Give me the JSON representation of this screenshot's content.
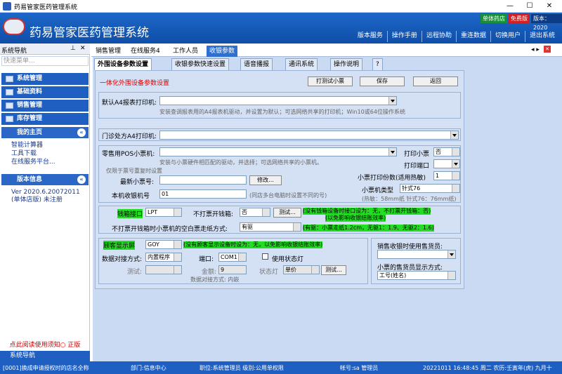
{
  "window": {
    "title": "药易管家医药管理系统",
    "min": "—",
    "max": "☐",
    "close": "✕"
  },
  "header": {
    "app_name": "药易管家医药管理系统",
    "badge1": "单体药店",
    "badge2": "免费版",
    "badge3": "版本：2020",
    "links": [
      "版本服务",
      "操作手册",
      "远程协助",
      "重连数据",
      "切换用户",
      "退出系统"
    ]
  },
  "sidebar": {
    "title": "系统导航",
    "search_placeholder": "快速菜单...",
    "menus": [
      "系统管理",
      "基础资料",
      "销售管理",
      "库存管理"
    ],
    "home_title": "我的主页",
    "home_links": [
      "智能计算器",
      "工具下载",
      "在线服务平台..."
    ],
    "ver_title": "版本信息",
    "ver_text": "Ver 2020.6.20072011",
    "ver_sub": "(单体店版) 未注册",
    "notice": "点此阅读使用须知○ 正版",
    "footer": "系统导航"
  },
  "tabs": [
    "销售管理",
    "在线服务4",
    "工作人员",
    "收银参数"
  ],
  "subtabs": [
    "外围设备参数设置",
    "收银参数快速设置",
    "语音播报",
    "通讯系统",
    "操作说明",
    "?"
  ],
  "form": {
    "section_title": "一体化外围设备参数设置",
    "btn_print": "打测试小票",
    "btn_save": "保存",
    "btn_back": "返回",
    "a4_label": "默认A4报表打印机:",
    "a4_hint": "安装查调报表用的A4报表机驱动，并设置为默认；可选网络共享的打印机；Win10或64位操作系统",
    "clinic_label": "门诊处方A4打印机:",
    "pos_label": "零售用POS小票机:",
    "pos_hint": "安装与小票硬件相匹配的驱动，并选择；可选网络共享的小票机。",
    "print_ticket_label": "打印小票",
    "print_ticket_val": "否",
    "print_port_label": "打印端口",
    "limit_title": "仅限于票号重复时设置",
    "latest_label": "最新小票号:",
    "modify_btn": "修改...",
    "copies_label": "小票打印份数(适用热敏)",
    "copies_val": "1",
    "type_label": "小票机类型",
    "type_val": "针式76",
    "type_hint": "(热敏：58mm纸  针式76：76mm纸)",
    "machine_label": "本机收银机号",
    "machine_val": "01",
    "machine_hint": "(同店多台电脑时设置不同的号)",
    "drawer_label": "钱箱接口",
    "drawer_val": "LPT",
    "nodrawer_label": "不打票开钱箱:",
    "nodrawer_val": "否",
    "test_btn": "测试...",
    "drawer_note1": "(没有钱箱设备时接口设为：无，不打票开钱箱：否)",
    "drawer_note2": "(以免影响收银结账效率)",
    "feed_label": "不打票开钱箱时小票机的空白票走纸方式:",
    "feed_val": "有驱",
    "feed_note": "(有驱：小票走纸1.2cm，无驱1：1.9、无驱2：1.6)",
    "disp_label": "顾客显示屏",
    "disp_val": "GOY",
    "disp_note": "(没有顾客显示设备时设为：无，以免影响收银结账效率)",
    "proto_label": "数据对接方式:",
    "proto_val": "内置程序",
    "port_label": "端口:",
    "port_val": "COM1",
    "status_lamp": "使用状态灯",
    "test_label": "测试:",
    "amount_label": "金额:",
    "amount_val": "9",
    "lamp_label": "状态灯",
    "lamp_val": "单价",
    "test_btn2": "测试...",
    "proto_note": "数据对接方式: 内嵌",
    "cashier_label": "销售收银时使用售货员:",
    "cashier_mode_label": "小票的售货员显示方式:",
    "cashier_mode_val": "工号(姓名)"
  },
  "status": {
    "s1": "[0001]换成申请授权时的店名全称",
    "s2": "部门:信息中心",
    "s3": "职位:系统管理员 级别:公用单权限",
    "s4": "帐号:sa 管理员",
    "s5": "20221011  16:48:45  周二  农历:壬寅年(虎) 九月十"
  }
}
